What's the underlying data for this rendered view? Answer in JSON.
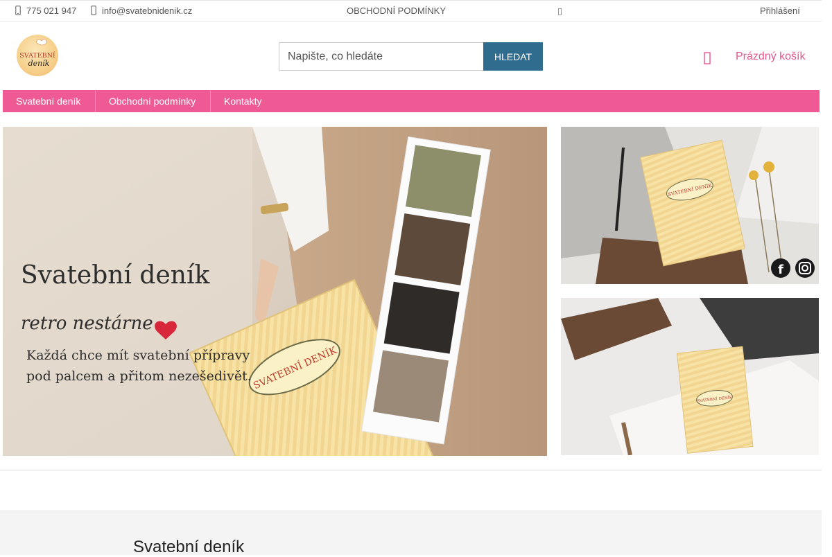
{
  "topbar": {
    "phone": "775 021 947",
    "email": "info@svatebnidenik.cz",
    "terms_link": "OBCHODNÍ PODMÍNKY",
    "login": "Přihlášení",
    "icons": [
      "phone-icon",
      "email-icon",
      "social-icon"
    ]
  },
  "header": {
    "logo_text_1": "SVATEBNÍ",
    "logo_text_2": "deník",
    "search_placeholder": "Napište, co hledáte",
    "search_button": "HLEDAT",
    "cart_label": "Prázdný košík"
  },
  "nav": {
    "items": [
      {
        "label": "Svatební deník"
      },
      {
        "label": "Obchodní podmínky"
      },
      {
        "label": "Kontakty"
      }
    ]
  },
  "hero": {
    "title": "Svatební deník",
    "subtitle": "retro nestárne",
    "line1": "Každá chce mít svatební přípravy",
    "line2": "pod palcem a přitom nezešedivět.",
    "book_title": "SVATEBNÍ DENÍK"
  },
  "side_banners": {
    "book_title": "SVATEBNÍ DENÍK",
    "social": [
      "facebook-icon",
      "instagram-icon"
    ]
  },
  "footer": {
    "heading": "Svatební deník"
  },
  "colors": {
    "accent_pink": "#ef5a95",
    "button_blue": "#2f6c8e",
    "cart_text": "#e8568e"
  }
}
